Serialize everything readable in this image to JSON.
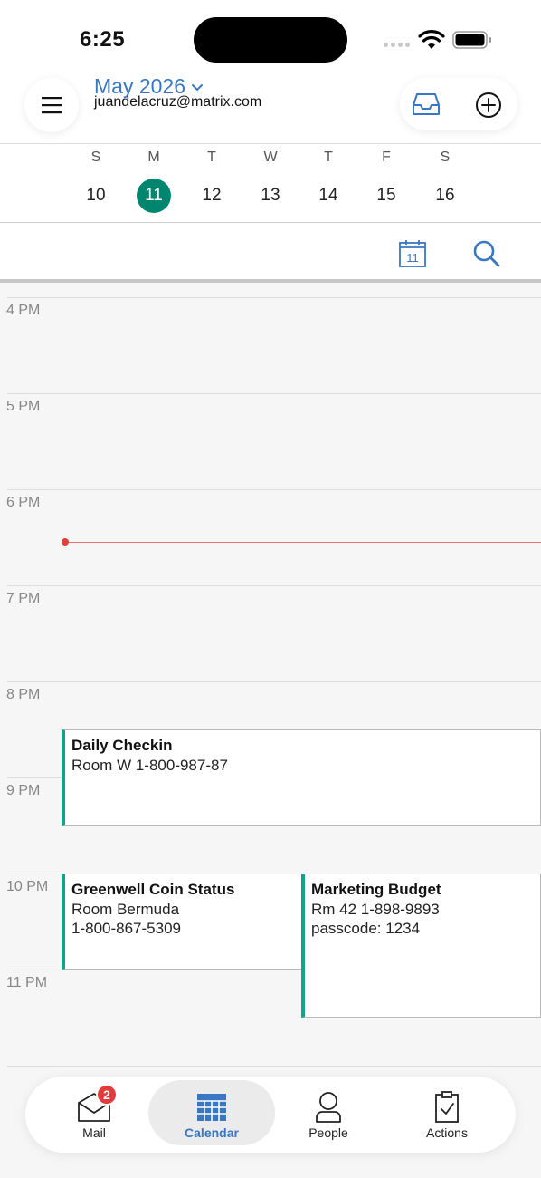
{
  "status_bar": {
    "time": "6:25"
  },
  "header": {
    "month": "May 2026",
    "account": "juandelacruz@matrix.com"
  },
  "week": {
    "days": [
      {
        "letter": "S",
        "num": "10",
        "selected": false
      },
      {
        "letter": "M",
        "num": "11",
        "selected": true
      },
      {
        "letter": "T",
        "num": "12",
        "selected": false
      },
      {
        "letter": "W",
        "num": "13",
        "selected": false
      },
      {
        "letter": "T",
        "num": "14",
        "selected": false
      },
      {
        "letter": "F",
        "num": "15",
        "selected": false
      },
      {
        "letter": "S",
        "num": "16",
        "selected": false
      }
    ]
  },
  "toolbar": {
    "today_day": "11"
  },
  "timeline": {
    "hours": [
      "4 PM",
      "5 PM",
      "6 PM",
      "7 PM",
      "8 PM",
      "9 PM",
      "10 PM",
      "11 PM"
    ],
    "events": [
      {
        "title": "Daily Checkin",
        "detail": "Room W 1-800-987-87"
      },
      {
        "title": "Greenwell Coin Status",
        "detail": "Room Bermuda\n1-800-867-5309"
      },
      {
        "title": "Marketing Budget",
        "detail": "Rm 42 1-898-9893\npasscode: 1234"
      }
    ]
  },
  "tabs": [
    {
      "label": "Mail",
      "badge": "2"
    },
    {
      "label": "Calendar"
    },
    {
      "label": "People"
    },
    {
      "label": "Actions"
    }
  ],
  "colors": {
    "accent": "#3a77c2",
    "selected_day": "#00866e",
    "event_bar": "#10a48d",
    "now_indicator": "#e0413b",
    "badge": "#e23b3b"
  }
}
